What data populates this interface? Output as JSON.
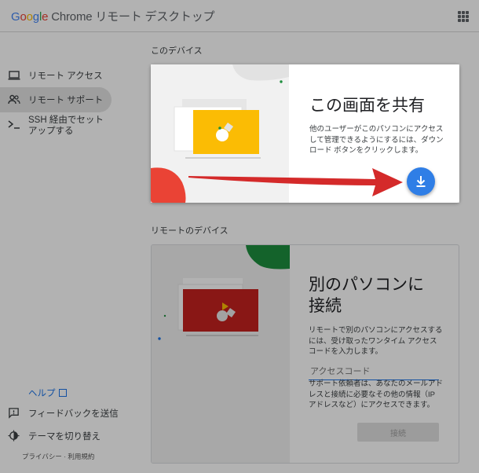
{
  "header": {
    "logo_google": [
      "G",
      "o",
      "o",
      "g",
      "l",
      "e"
    ],
    "app_title": "Chrome リモート デスクトップ",
    "apps_icon": "apps-grid-icon"
  },
  "sidebar": {
    "items": [
      {
        "label": "リモート アクセス",
        "icon": "laptop-icon",
        "active": false
      },
      {
        "label": "リモート サポート",
        "icon": "people-icon",
        "active": true
      },
      {
        "label": "SSH 経由でセットアップする",
        "icon": "terminal-icon",
        "active": false
      }
    ],
    "help_label": "ヘルプ",
    "footer": [
      {
        "label": "フィードバックを送信",
        "icon": "feedback-icon"
      },
      {
        "label": "テーマを切り替え",
        "icon": "theme-icon"
      }
    ],
    "privacy": "プライバシー · 利用規約"
  },
  "main": {
    "share_section_title": "このデバイス",
    "share_card": {
      "heading": "この画面を共有",
      "body": "他のユーザーがこのパソコンにアクセスして管理できるようにするには、ダウンロード ボタンをクリックします。",
      "button_icon": "download-icon"
    },
    "remote_section_title": "リモートのデバイス",
    "remote_card": {
      "heading_line1": "別のパソコンに",
      "heading_line2": "接続",
      "body": "リモートで別のパソコンにアクセスするには、受け取ったワンタイム アクセスコードを入力します。",
      "input_placeholder": "アクセスコード",
      "note": "サポート依頼者は、あなたのメールアドレスと接続に必要なその他の情報（IP アドレスなど）にアクセスできます。",
      "connect_label": "接続"
    }
  },
  "colors": {
    "accent_blue": "#2f7ee6",
    "arrow_red": "#d42a2a",
    "illustration_yellow": "#fbbc04",
    "illustration_red": "#ea4335",
    "illustration_green": "#1e8e3e"
  }
}
